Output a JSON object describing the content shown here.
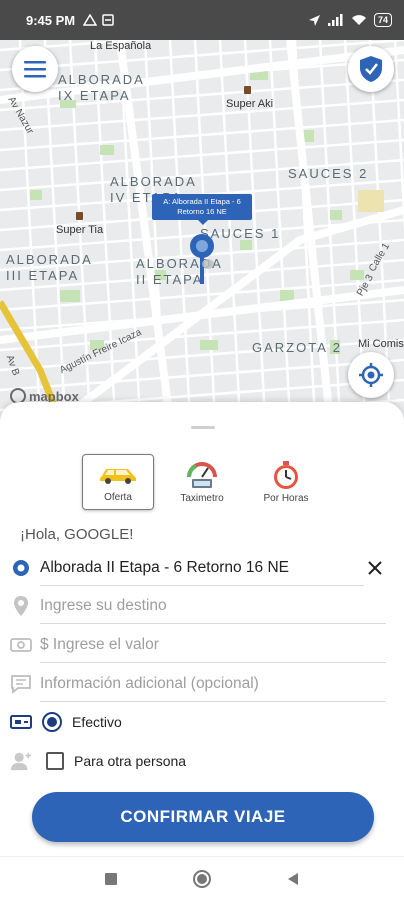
{
  "status_bar": {
    "time": "9:45 PM",
    "battery": "74"
  },
  "map": {
    "neighborhoods": [
      {
        "id": "alborada-ix",
        "text": "ALBORADA\nIX ETAPA"
      },
      {
        "id": "alborada-iv",
        "text": "ALBORADA\nIV ETAPA"
      },
      {
        "id": "alborada-iii",
        "text": "ALBORADA\nIII ETAPA"
      },
      {
        "id": "alborada-ii",
        "text": "ALBORADA\nII ETAPA"
      },
      {
        "id": "sauces-2",
        "text": "SAUCES 2"
      },
      {
        "id": "sauces-1",
        "text": "SAUCES 1"
      },
      {
        "id": "garzota-2",
        "text": "GARZOTA 2"
      }
    ],
    "places": [
      "La Española",
      "Super Aki",
      "Super Tia",
      "Mi Comis"
    ],
    "streets": [
      "Agustín Freire Icaza",
      "Calle 1",
      "Pje 3",
      "Av Nazur",
      "Av B"
    ],
    "tooltip": "A: Alborada II Etapa - 6 Retorno 16 NE",
    "attribution": "mapbox",
    "route_color": "#e6c43a",
    "accent": "#2d64b8"
  },
  "modes": [
    {
      "label": "Oferta",
      "icon": "taxi-icon",
      "selected": true
    },
    {
      "label": "Taximetro",
      "icon": "taximeter-icon",
      "selected": false
    },
    {
      "label": "Por Horas",
      "icon": "stopwatch-icon",
      "selected": false
    }
  ],
  "greeting": "¡Hola, GOOGLE!",
  "form": {
    "origin": "Alborada II Etapa - 6 Retorno 16 NE",
    "destination_placeholder": "Ingrese su destino",
    "value_placeholder": "$ Ingrese el valor",
    "info_placeholder": "Información adicional (opcional)",
    "payment_label": "Efectivo",
    "other_person_label": "Para otra persona"
  },
  "confirm_label": "CONFIRMAR VIAJE"
}
